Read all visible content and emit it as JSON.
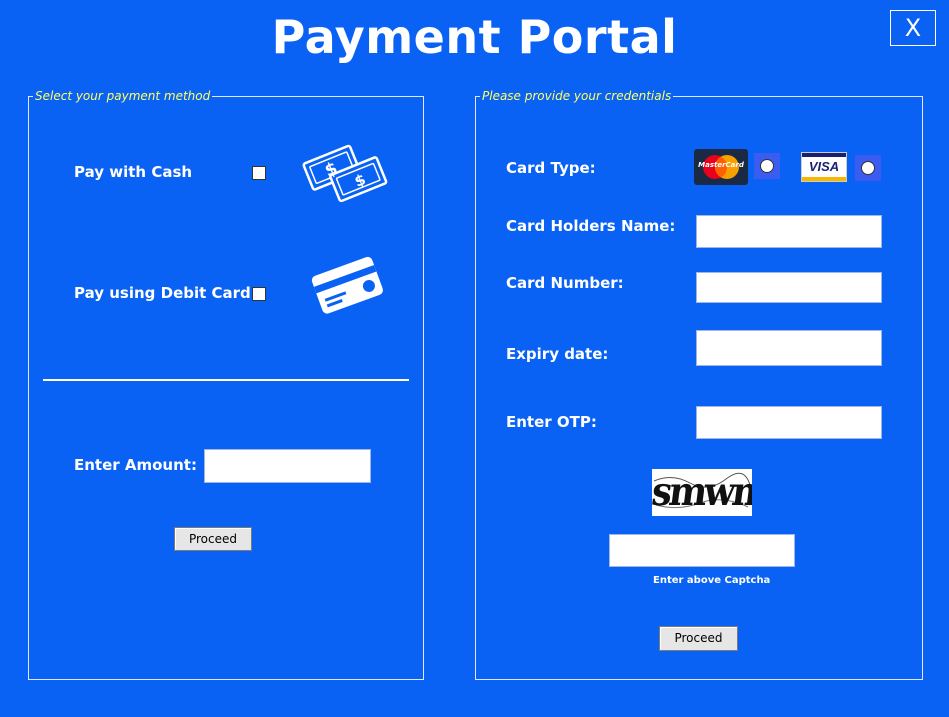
{
  "header": {
    "title": "Payment Portal",
    "close_label": "X"
  },
  "left_panel": {
    "legend": "Select your payment method",
    "options": [
      {
        "label": "Pay with Cash",
        "checked": false,
        "icon": "cash-icon"
      },
      {
        "label": "Pay using Debit Card",
        "checked": false,
        "icon": "debit-card-icon"
      }
    ],
    "amount_label": "Enter Amount:",
    "amount_value": "",
    "proceed_label": "Proceed"
  },
  "right_panel": {
    "legend": "Please provide your credentials",
    "card_type_label": "Card Type:",
    "card_types": [
      {
        "name": "MasterCard",
        "text": "MasterCard",
        "selected": false
      },
      {
        "name": "Visa",
        "text": "VISA",
        "selected": false
      }
    ],
    "fields": [
      {
        "label": "Card Holders Name:",
        "value": ""
      },
      {
        "label": "Card Number:",
        "value": ""
      },
      {
        "label": "Expiry date:",
        "value": ""
      },
      {
        "label": "Enter OTP:",
        "value": ""
      }
    ],
    "captcha_text": "smwm",
    "captcha_input_value": "",
    "captcha_note": "Enter above Captcha",
    "proceed_label": "Proceed"
  },
  "colors": {
    "background": "#0a62f5",
    "legend_text": "#ffff66",
    "radio_bg": "#3b5cf0"
  }
}
